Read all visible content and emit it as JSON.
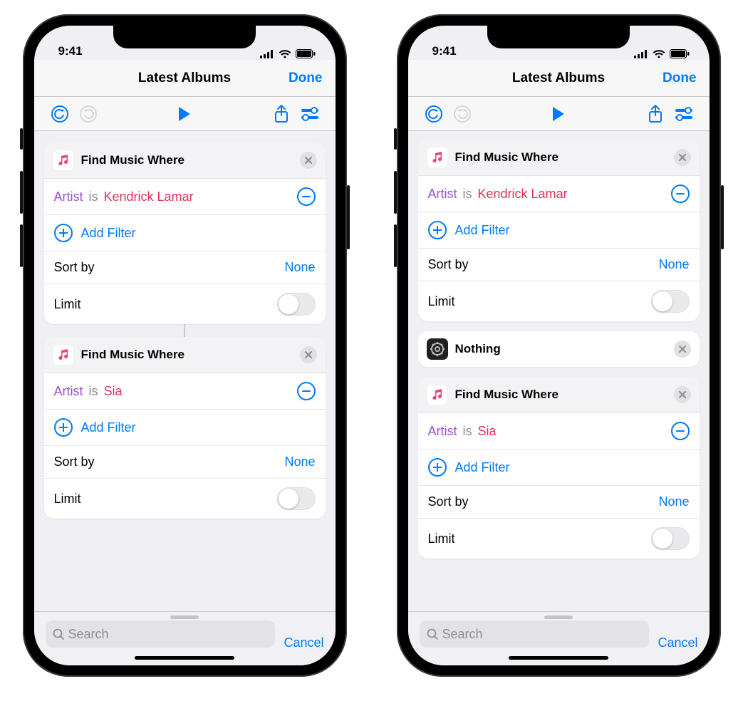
{
  "statusbar": {
    "time": "9:41"
  },
  "navbar": {
    "title": "Latest Albums",
    "done": "Done"
  },
  "labels": {
    "add_filter": "Add Filter",
    "sort_by": "Sort by",
    "sort_value": "None",
    "limit": "Limit",
    "search_placeholder": "Search",
    "cancel": "Cancel"
  },
  "left": {
    "cards": [
      {
        "type": "find",
        "title": "Find Music Where",
        "filter_field": "Artist",
        "filter_op": "is",
        "filter_value": "Kendrick Lamar"
      },
      {
        "type": "find",
        "title": "Find Music Where",
        "filter_field": "Artist",
        "filter_op": "is",
        "filter_value": "Sia"
      }
    ]
  },
  "right": {
    "cards": [
      {
        "type": "find",
        "title": "Find Music Where",
        "filter_field": "Artist",
        "filter_op": "is",
        "filter_value": "Kendrick Lamar"
      },
      {
        "type": "nothing",
        "title": "Nothing"
      },
      {
        "type": "find",
        "title": "Find Music Where",
        "filter_field": "Artist",
        "filter_op": "is",
        "filter_value": "Sia"
      }
    ]
  }
}
